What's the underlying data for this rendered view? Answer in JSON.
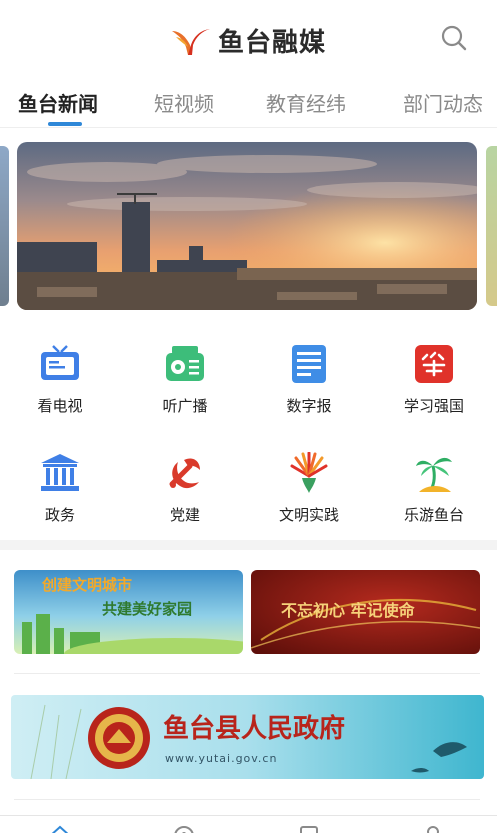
{
  "header": {
    "app_title": "鱼台融媒",
    "logo_icon": "yutai-logo-icon",
    "search_icon": "search-icon"
  },
  "tabs": [
    {
      "label": "鱼台新闻",
      "active": true
    },
    {
      "label": "短视频",
      "active": false
    },
    {
      "label": "教育经纬",
      "active": false
    },
    {
      "label": "部门动态",
      "active": false
    }
  ],
  "carousel": {
    "image": "sunset-city-skyline"
  },
  "services": [
    {
      "label": "看电视",
      "icon": "tv-icon"
    },
    {
      "label": "听广播",
      "icon": "radio-icon"
    },
    {
      "label": "数字报",
      "icon": "newspaper-icon"
    },
    {
      "label": "学习强国",
      "icon": "xuexi-qiangguo-icon"
    },
    {
      "label": "政务",
      "icon": "government-building-icon"
    },
    {
      "label": "党建",
      "icon": "party-emblem-icon"
    },
    {
      "label": "文明实践",
      "icon": "civilization-fan-icon"
    },
    {
      "label": "乐游鱼台",
      "icon": "palm-tree-icon"
    }
  ],
  "promos": {
    "left": {
      "line1": "创建文明城市",
      "line2": "共建美好家园"
    },
    "right": {
      "text": "不忘初心 牢记使命"
    }
  },
  "gov_banner": {
    "title": "鱼台县人民政府",
    "url": "www.yutai.gov.cn"
  },
  "colors": {
    "accent": "#2f88d8",
    "party_red": "#d93a2b",
    "xuexi_red": "#e0322a",
    "service_green": "#3dbd7a"
  }
}
